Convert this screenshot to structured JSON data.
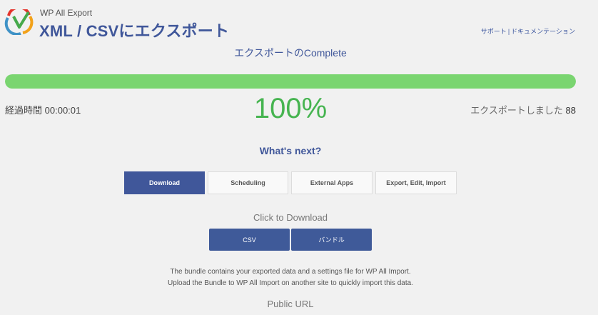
{
  "header": {
    "brand_sub": "WP All Export",
    "title": "XML / CSVにエクスポート",
    "links": [
      {
        "label": "サポート"
      },
      {
        "label": "ドキュメンテーション"
      }
    ],
    "link_separator": "|"
  },
  "status": {
    "heading": "エクスポートのComplete",
    "progress_fraction": 1.0,
    "percent_text": "100%",
    "elapsed_label": "経過時間",
    "elapsed_value": "00:00:01",
    "exported_label": "エクスポートしました",
    "exported_count": "88"
  },
  "next": {
    "heading": "What's next?",
    "tabs": [
      {
        "label": "Download",
        "active": true
      },
      {
        "label": "Scheduling",
        "active": false
      },
      {
        "label": "External Apps",
        "active": false
      },
      {
        "label": "Export, Edit, Import",
        "active": false
      }
    ]
  },
  "download": {
    "label": "Click to Download",
    "buttons": [
      {
        "label": "CSV"
      },
      {
        "label": "バンドル"
      }
    ],
    "note_line1": "The bundle contains your exported data and a settings file for WP All Import.",
    "note_line2": "Upload the Bundle to WP All Import on another site to quickly import this data.",
    "public_url_label": "Public URL"
  },
  "colors": {
    "accent": "#40579a",
    "progress": "#7ad570",
    "percent": "#46b450"
  },
  "icons": {
    "logo": "wp-all-export-logo-icon"
  }
}
